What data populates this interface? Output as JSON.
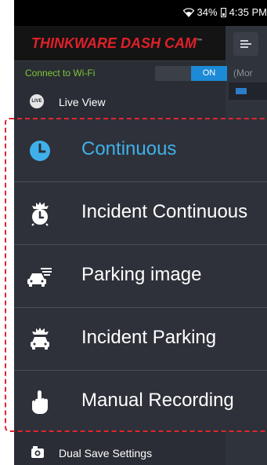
{
  "status_bar": {
    "battery": "34%",
    "time": "4:35 PM"
  },
  "drawer": {
    "brand": "THINKWARE DASH CAM",
    "brand_tm": "™",
    "wifi": {
      "label": "Connect to Wi-Fi",
      "toggle_value": "ON"
    },
    "live_view": {
      "icon_text": "LIVE",
      "label": "Live View"
    },
    "dual_save": {
      "label": "Dual Save Settings"
    }
  },
  "app_background": {
    "partial_label": "(Mor"
  },
  "recording_menu": {
    "items": [
      {
        "label": "Continuous",
        "icon": "clock-icon",
        "selected": true
      },
      {
        "label": "Incident Continuous",
        "icon": "alarm-clock-icon",
        "selected": false
      },
      {
        "label": "Parking image",
        "icon": "parked-car-icon",
        "selected": false
      },
      {
        "label": "Incident Parking",
        "icon": "car-impact-icon",
        "selected": false
      },
      {
        "label": "Manual Recording",
        "icon": "hand-pointer-icon",
        "selected": false
      }
    ]
  },
  "colors": {
    "accent": "#3fb1ea",
    "brand_red": "#e0202a",
    "wifi_green": "#7ec73a",
    "toggle_blue": "#1c8ad6",
    "highlight_red": "#e1252e"
  }
}
